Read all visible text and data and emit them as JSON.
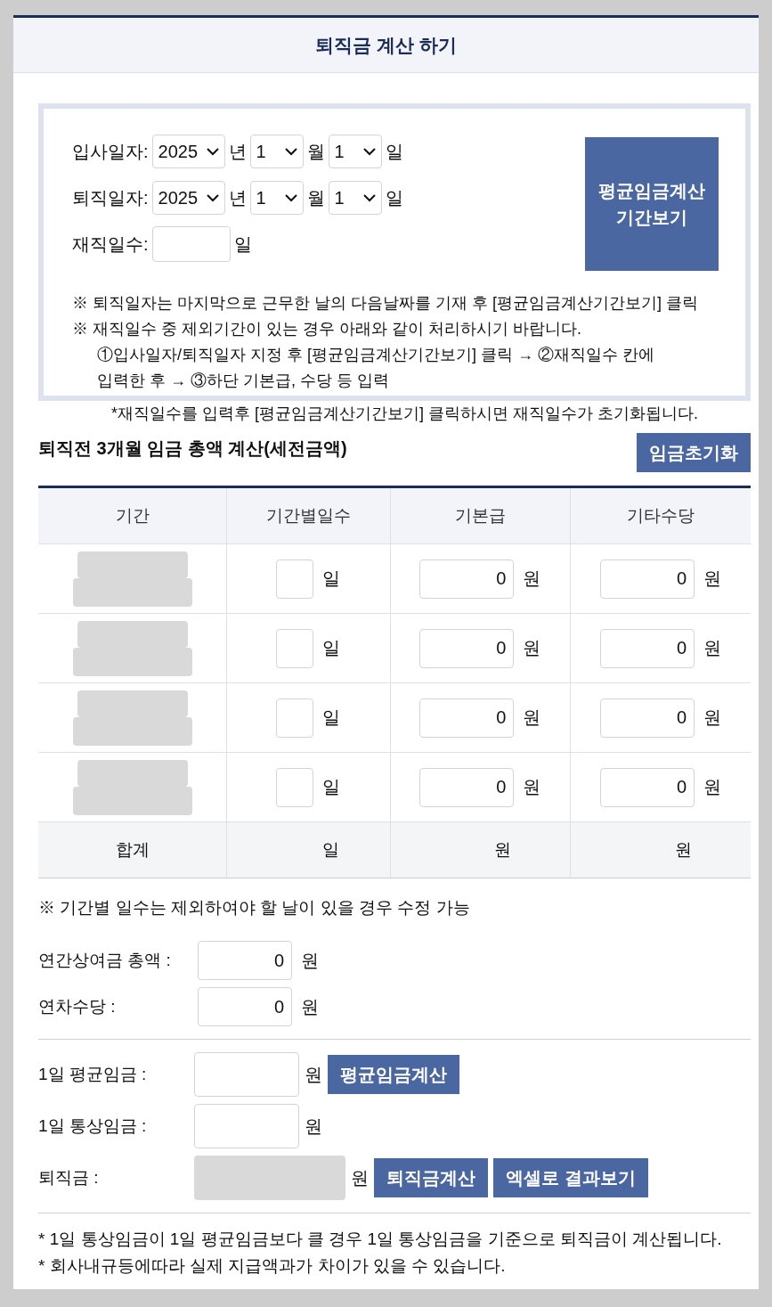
{
  "title": "퇴직금 계산 하기",
  "dates": [
    {
      "label": "입사일자:",
      "year": "2025",
      "year_unit": "년",
      "month": "1",
      "month_unit": "월",
      "day": "1",
      "day_unit": "일"
    },
    {
      "label": "퇴직일자:",
      "year": "2025",
      "year_unit": "년",
      "month": "1",
      "month_unit": "월",
      "day": "1",
      "day_unit": "일"
    }
  ],
  "work_days": {
    "label": "재직일수:",
    "unit": "일"
  },
  "period_button": {
    "lines": [
      "평균임금계산",
      "기간보기"
    ]
  },
  "notes": [
    {
      "kind": "note",
      "text": "※ 퇴직일자는 마지막으로 근무한 날의 다음날짜를 기재 후 [평균임금계산기간보기] 클릭"
    },
    {
      "kind": "note",
      "text": "※ 재직일수 중 제외기간이 있는 경우 아래와 같이 처리하시기 바랍니다."
    },
    {
      "kind": "step",
      "text": "①입사일자/퇴직일자 지정 후 [평균임금계산기간보기] 클릭 → ②재직일수 칸에 입력한 후 → ③하단 기본급, 수당 등 입력"
    }
  ],
  "warning": "*재직일수를 입력후 [평균임금계산기간보기] 클릭하시면 재직일수가 초기화됩니다.",
  "section_title": "퇴직전 3개월 임금 총액 계산(세전금액)",
  "reset_button": "임금초기화",
  "table": {
    "columns": [
      "기간",
      "기간별일수",
      "기본급",
      "기타수당"
    ],
    "rows": [
      {
        "period_disabled": true,
        "day_unit": "일",
        "base": "0",
        "base_unit": "원",
        "extra": "0",
        "extra_unit": "원"
      },
      {
        "period_disabled": true,
        "day_unit": "일",
        "base": "0",
        "base_unit": "원",
        "extra": "0",
        "extra_unit": "원"
      },
      {
        "period_disabled": true,
        "day_unit": "일",
        "base": "0",
        "base_unit": "원",
        "extra": "0",
        "extra_unit": "원"
      },
      {
        "period_disabled": true,
        "day_unit": "일",
        "base": "0",
        "base_unit": "원",
        "extra": "0",
        "extra_unit": "원"
      }
    ],
    "total": {
      "label": "합계",
      "days": "일",
      "base": "원",
      "extra": "원"
    }
  },
  "table_note": "※ 기간별 일수는 제외하여야 할 날이 있을 경우 수정 가능",
  "bonus_fields": [
    {
      "label": "연간상여금 총액 :",
      "value": "0",
      "unit": "원"
    },
    {
      "label": "연차수당 :",
      "value": "0",
      "unit": "원"
    }
  ],
  "result_fields": [
    {
      "label": "1일 평균임금 :",
      "unit": "원",
      "disabled": false,
      "buttons": [
        "평균임금계산"
      ]
    },
    {
      "label": "1일 통상임금 :",
      "unit": "원",
      "disabled": false
    },
    {
      "label": "퇴직금 :",
      "unit": "원",
      "disabled": true,
      "buttons": [
        "퇴직금계산",
        "엑셀로 결과보기"
      ]
    }
  ],
  "footnotes": [
    "* 1일 통상임금이 1일 평균임금보다 클 경우 1일 통상임금을 기준으로 퇴직금이 계산됩니다.",
    "* 회사내규등에따라 실제 지급액과가 차이가 있을 수 있습니다."
  ]
}
